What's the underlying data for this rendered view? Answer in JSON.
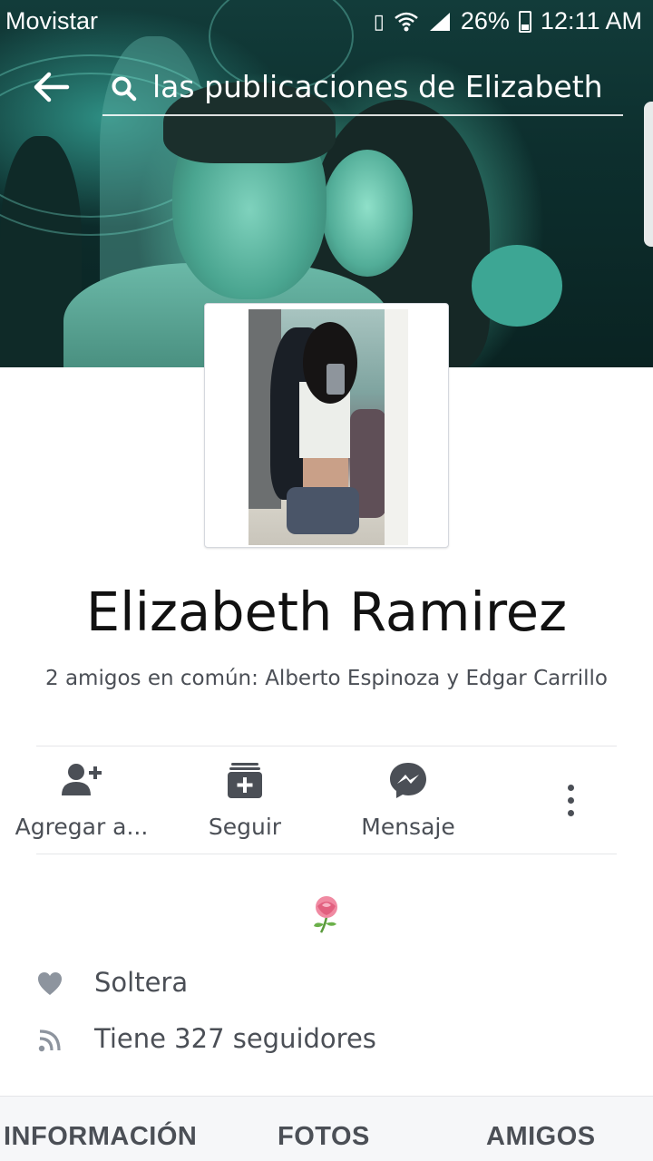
{
  "status_bar": {
    "carrier": "Movistar",
    "battery": "26%",
    "time": "12:11 AM"
  },
  "search": {
    "query": "las publicaciones de Elizabeth"
  },
  "profile": {
    "name": "Elizabeth Ramirez",
    "mutual_friends": "2 amigos en común: Alberto Espinoza y Edgar Carrillo"
  },
  "actions": [
    {
      "label": "Agregar a...",
      "icon": "add-friend-icon"
    },
    {
      "label": "Seguir",
      "icon": "follow-icon"
    },
    {
      "label": "Mensaje",
      "icon": "messenger-icon"
    }
  ],
  "bio": {
    "emoji": "rose-icon",
    "relationship": "Soltera",
    "followers": "Tiene 327 seguidores"
  },
  "tabs": [
    "INFORMACIÓN",
    "FOTOS",
    "AMIGOS"
  ],
  "colors": {
    "icon_gray": "#4b4f56",
    "divider": "#e5e6e9",
    "tab_background": "#f6f7f9"
  }
}
